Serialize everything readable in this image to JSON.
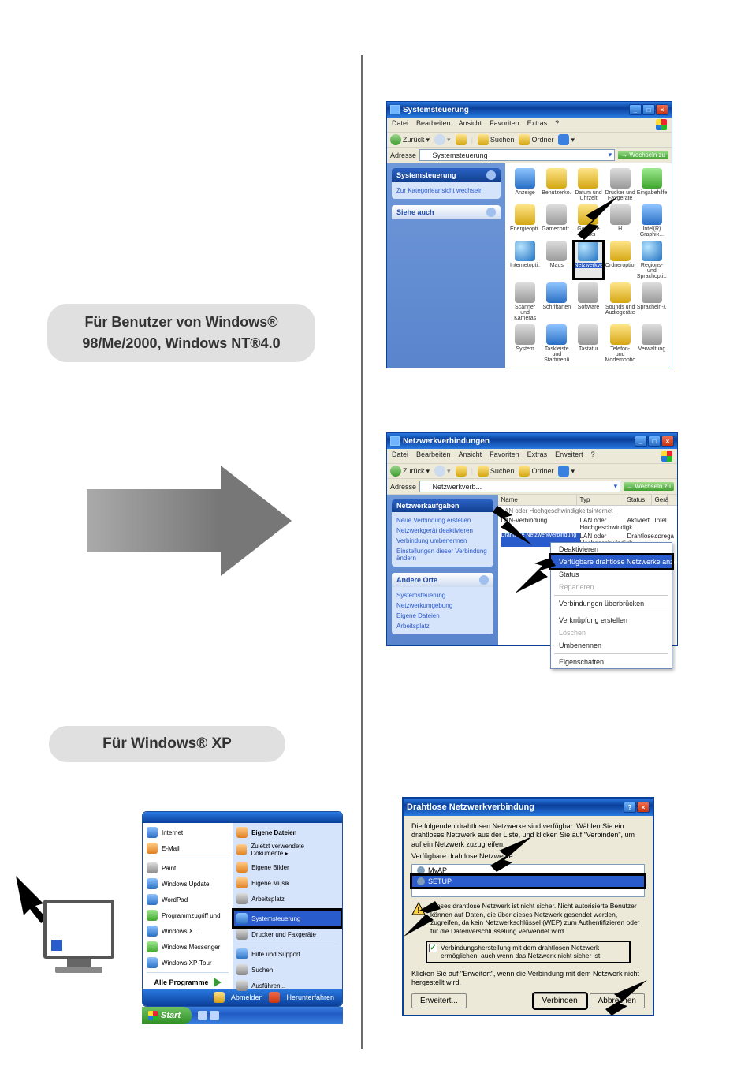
{
  "pills": {
    "p1_line1": "Für Benutzer von Windows®",
    "p1_line2": "98/Me/2000, Windows NT®4.0",
    "p2": "Für Windows® XP"
  },
  "win1": {
    "title": "Systemsteuerung",
    "menu": [
      "Datei",
      "Bearbeiten",
      "Ansicht",
      "Favoriten",
      "Extras",
      "?"
    ],
    "back": "Zurück",
    "search": "Suchen",
    "folders": "Ordner",
    "address_label": "Adresse",
    "address_value": "Systemsteuerung",
    "go": "Wechseln zu",
    "sidebar": {
      "head": "Systemsteuerung",
      "switch": "Zur Kategorieansicht wechseln",
      "see_also": "Siehe auch"
    },
    "items": [
      "Anzeige",
      "Benutzerko...",
      "Datum und Uhrzeit",
      "Drucker und Faxgeräte",
      "Eingabehilfen",
      "Energieopti...",
      "Gamecontr...",
      "Geplante Tasks",
      "H",
      "Intel(R) Graphik...",
      "Internetopti...",
      "Maus",
      "Netzwerkverbindungen",
      "Ordneroptio...",
      "Regions- und Sprachopti...",
      "Scanner und Kameras",
      "Schriftarten",
      "Software",
      "Sounds und Audiogeräte",
      "Sprachein-/...",
      "System",
      "Taskleiste und Startmenü",
      "Tastatur",
      "Telefon- und Modemoptio...",
      "Verwaltung"
    ],
    "highlight_index": 12
  },
  "win2": {
    "title": "Netzwerkverbindungen",
    "menu": [
      "Datei",
      "Bearbeiten",
      "Ansicht",
      "Favoriten",
      "Extras",
      "Erweitert",
      "?"
    ],
    "back": "Zurück",
    "search": "Suchen",
    "folders": "Ordner",
    "address_label": "Adresse",
    "address_value": "Netzwerkverb...",
    "go": "Wechseln zu",
    "cols": {
      "name": "Name",
      "typ": "Typ",
      "status": "Status",
      "ger": "Gerä"
    },
    "category": "LAN oder Hochgeschwindigkeitsinternet",
    "rows": [
      {
        "name": "LAN-Verbindung",
        "typ": "LAN oder Hochgeschwindigk...",
        "status": "Aktiviert",
        "ger": "Intel"
      },
      {
        "name": "Drahtlose Netzwerkverbindung",
        "typ": "LAN oder Hochgeschwindigk...",
        "status": "Drahtlose...",
        "ger": "corega"
      }
    ],
    "tasks_head": "Netzwerkaufgaben",
    "tasks": [
      "Neue Verbindung erstellen",
      "Netzwerkgerät deaktivieren",
      "Verbindung umbenennen",
      "Einstellungen dieser Verbindung ändern"
    ],
    "places_head": "Andere Orte",
    "places": [
      "Systemsteuerung",
      "Netzwerkumgebung",
      "Eigene Dateien",
      "Arbeitsplatz"
    ],
    "context": [
      {
        "t": "Deaktivieren"
      },
      {
        "t": "Verfügbare drahtlose Netzwerke anzeigen",
        "hl": true
      },
      {
        "t": "Status"
      },
      {
        "t": "Reparieren",
        "dis": true
      },
      {
        "sep": true
      },
      {
        "t": "Verbindungen überbrücken"
      },
      {
        "sep": true
      },
      {
        "t": "Verknüpfung erstellen"
      },
      {
        "t": "Löschen",
        "dis": true
      },
      {
        "t": "Umbenennen"
      },
      {
        "sep": true
      },
      {
        "t": "Eigenschaften"
      }
    ]
  },
  "startmenu": {
    "top_item": "Eigene Dateien",
    "left": [
      "Internet",
      "E-Mail",
      "Paint",
      "Windows Update",
      "WordPad",
      "Programmzugriff und",
      "Windows X...",
      "Windows Messenger",
      "Windows XP-Tour"
    ],
    "all": "Alle Programme",
    "right": [
      "Zuletzt verwendete Dokumente ▸",
      "Eigene Bilder",
      "Eigene Musik",
      "Arbeitsplatz",
      "Systemsteuerung",
      "Drucker und Faxgeräte",
      "Hilfe und Support",
      "Suchen",
      "Ausführen..."
    ],
    "right_hl_index": 4,
    "logoff": "Abmelden",
    "shutdown": "Herunterfahren",
    "start": "Start"
  },
  "dialog": {
    "title": "Drahtlose Netzwerkverbindung",
    "intro": "Die folgenden drahtlosen Netzwerke sind verfügbar. Wählen Sie ein drahtloses Netzwerk aus der Liste, und klicken Sie auf \"Verbinden\", um auf ein Netzwerk zuzugreifen.",
    "avail": "Verfügbare drahtlose Netzwerke:",
    "net1": "MyAP",
    "net2": "SETUP",
    "warn": "Dieses drahtlose Netzwerk ist nicht sicher. Nicht autorisierte Benutzer können auf Daten, die über dieses Netzwerk gesendet werden, zugreifen, da kein Netzwerkschlüssel (WEP) zum Authentifizieren oder für die Datenverschlüsselung verwendet wird.",
    "check": "Verbindungsherstellung mit dem drahtlosen Netzwerk ermöglichen, auch wenn das Netzwerk nicht sicher ist",
    "hint": "Klicken Sie auf \"Erweitert\", wenn die Verbindung mit dem Netzwerk nicht hergestellt wird.",
    "advanced": "Erweitert...",
    "connect": "Verbinden",
    "cancel": "Abbrechen"
  },
  "colors": {
    "xp_blue": "#0a3f9a",
    "accent": "#2a5bcc"
  }
}
